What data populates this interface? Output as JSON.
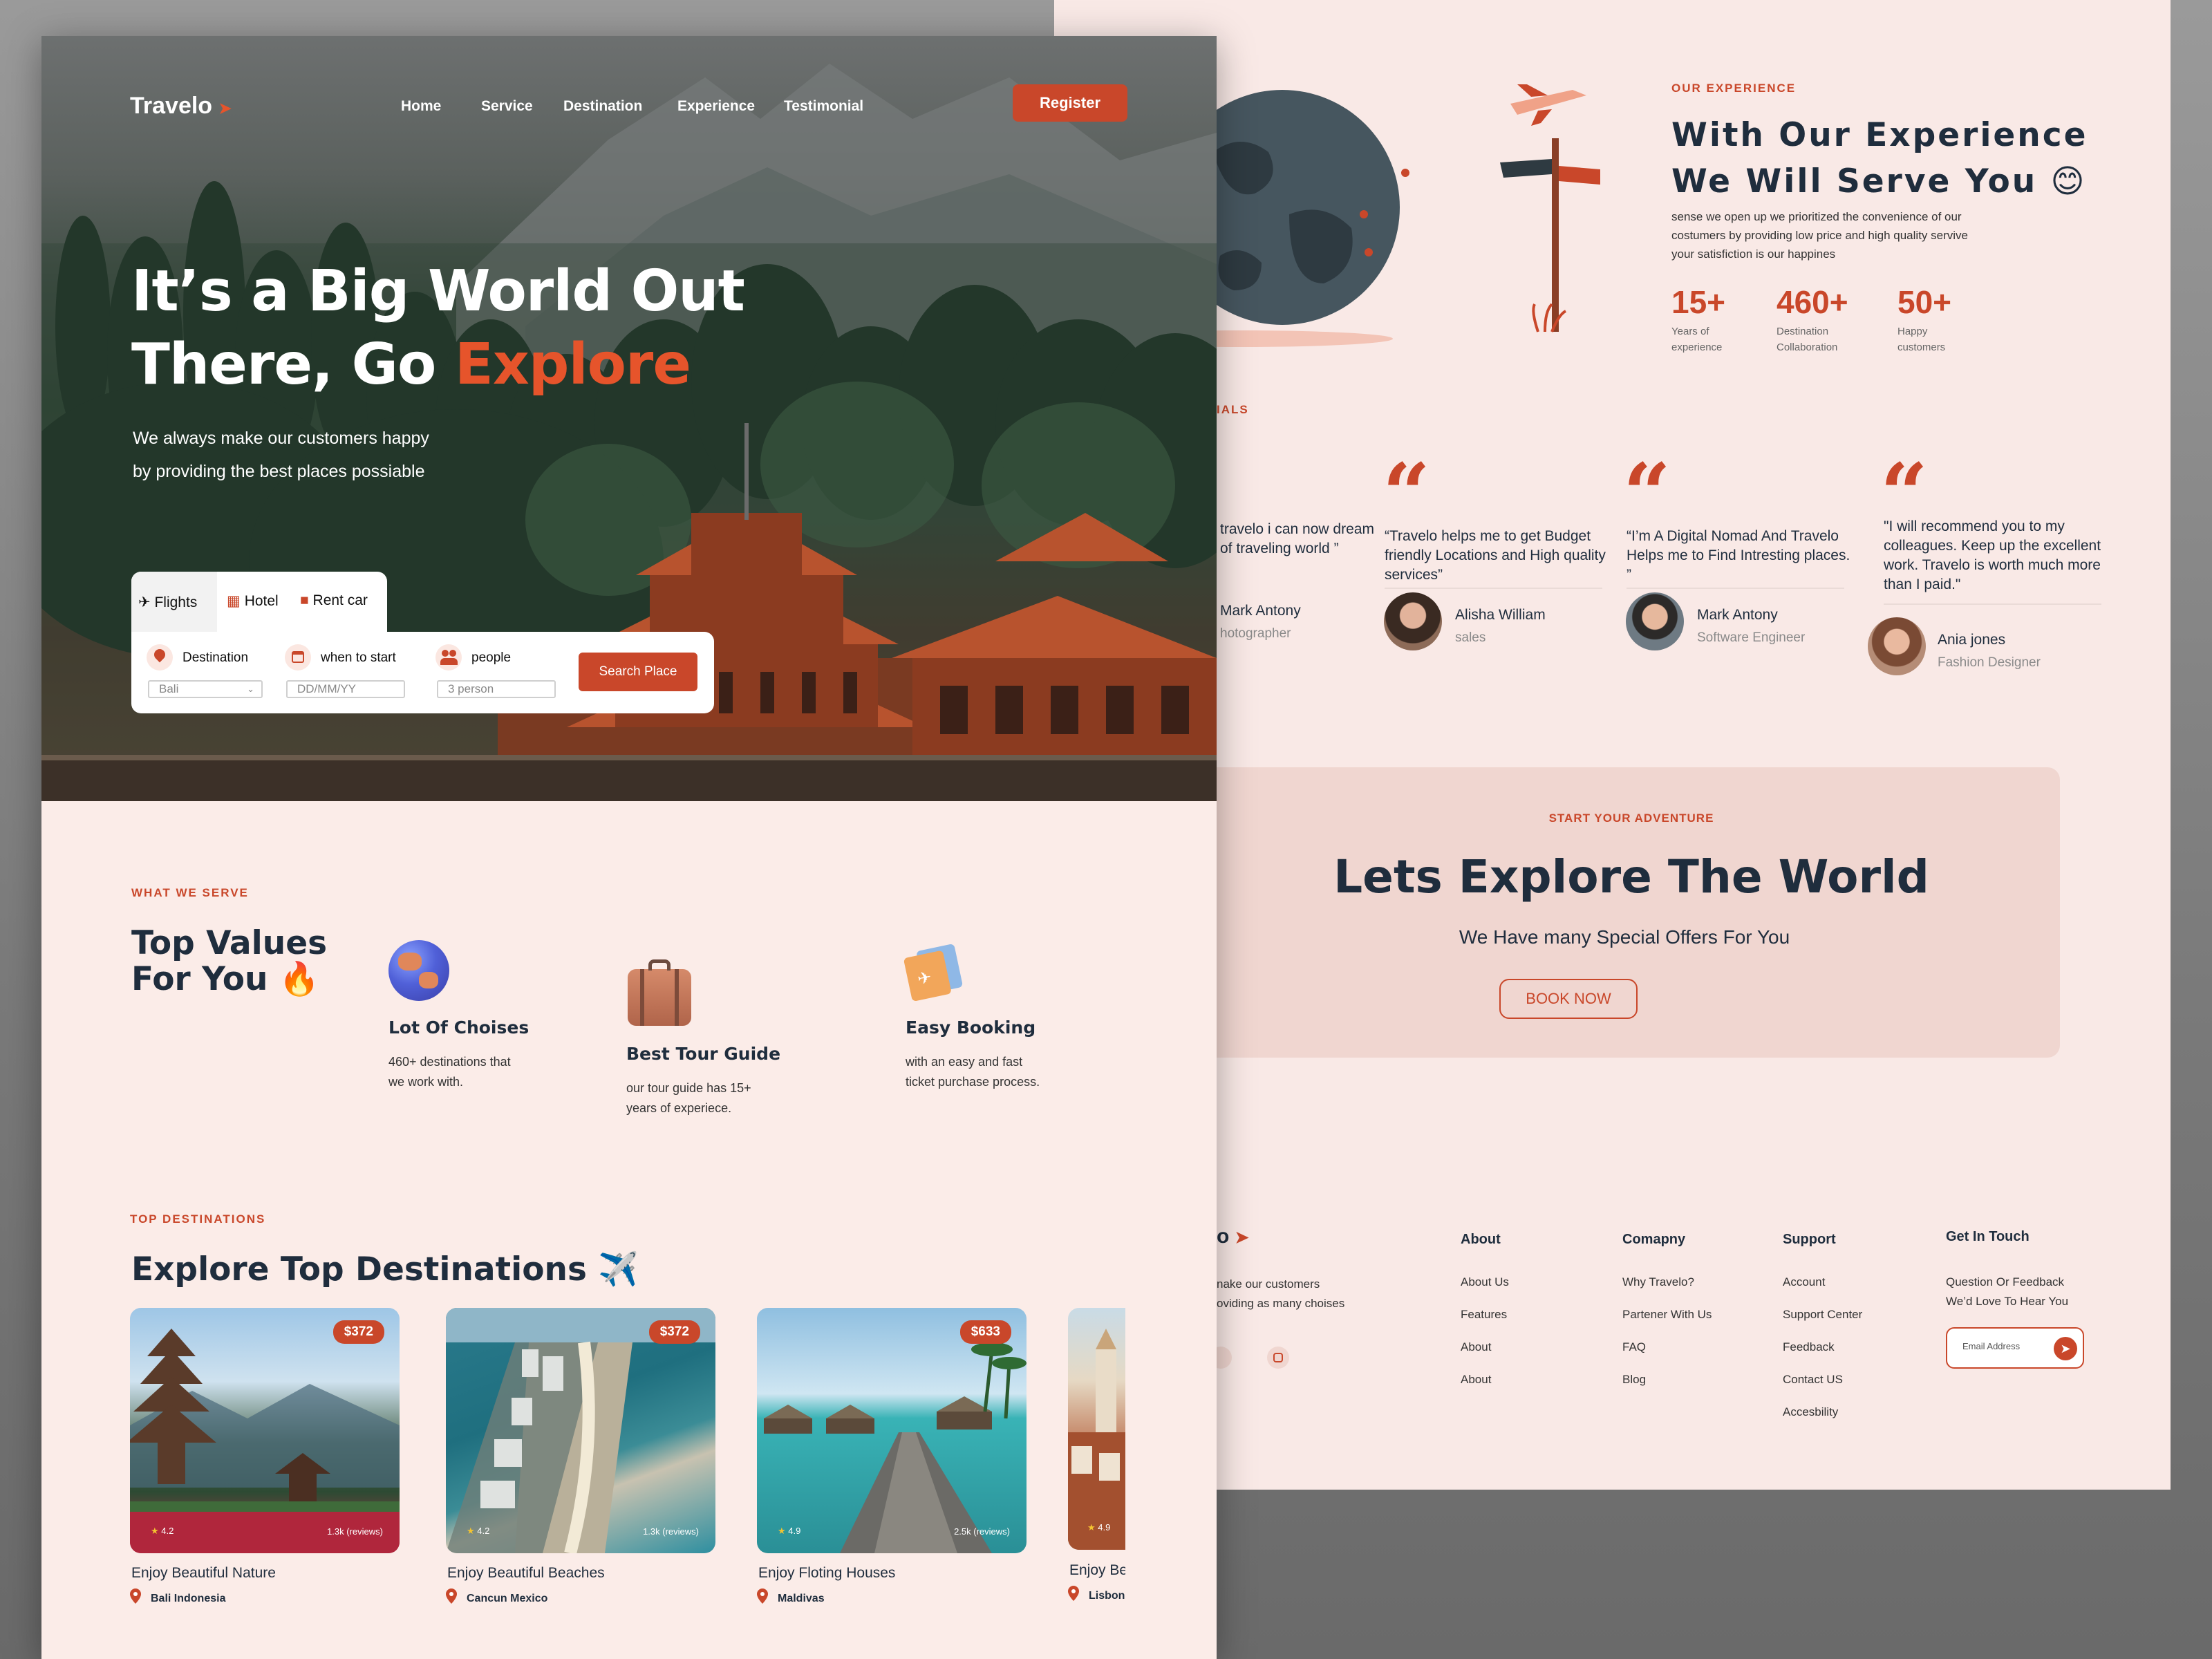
{
  "brand": {
    "name": "Travelo",
    "accent": "#c9472a"
  },
  "nav": {
    "links": [
      "Home",
      "Service",
      "Destination",
      "Experience",
      "Testimonial"
    ],
    "register": "Register"
  },
  "hero": {
    "title_line1": "It’s a Big World Out",
    "title_line2_prefix": "There, Go ",
    "title_line2_accent": "Explore",
    "sub_line1": "We always make our customers happy",
    "sub_line2": "by providing the best places possiable"
  },
  "search": {
    "tabs": [
      {
        "icon": "airplane-icon",
        "label": "Flights"
      },
      {
        "icon": "hotel-icon",
        "label": "Hotel"
      },
      {
        "icon": "car-icon",
        "label": "Rent car"
      }
    ],
    "fields": [
      {
        "icon": "location-pin-icon",
        "label": "Destination",
        "value": "Bali"
      },
      {
        "icon": "calendar-icon",
        "label": "when to start",
        "placeholder": "DD/MM/YY"
      },
      {
        "icon": "people-icon",
        "label": "people",
        "placeholder": "3 person"
      }
    ],
    "button": "Search Place"
  },
  "serve": {
    "eyebrow": "WHAT WE SERVE",
    "title_line1": "Top Values",
    "title_line2": "For You 🔥",
    "features": [
      {
        "icon": "globe-icon",
        "title": "Lot Of Choises",
        "text_line1": "460+ destinations that",
        "text_line2": "we work with."
      },
      {
        "icon": "suitcase-icon",
        "title": "Best Tour Guide",
        "text_line1": "our tour guide has 15+",
        "text_line2": "years of experiece."
      },
      {
        "icon": "ticket-icon",
        "title": "Easy Booking",
        "text_line1": "with an easy and fast",
        "text_line2": "ticket purchase process."
      }
    ]
  },
  "destinations": {
    "eyebrow": "TOP DESTINATIONS",
    "title": "Explore Top Destinations ✈️",
    "cards": [
      {
        "price": "$372",
        "rating": "4.2",
        "reviews": "1.3k (reviews)",
        "title": "Enjoy Beautiful Nature",
        "location": "Bali Indonesia"
      },
      {
        "price": "$372",
        "rating": "4.2",
        "reviews": "1.3k (reviews)",
        "title": "Enjoy Beautiful Beaches",
        "location": "Cancun Mexico"
      },
      {
        "price": "$633",
        "rating": "4.9",
        "reviews": "2.5k (reviews)",
        "title": "Enjoy Floting Houses",
        "location": "Maldivas"
      },
      {
        "price": "",
        "rating": "4.9",
        "reviews": "",
        "title": "Enjoy Be",
        "location": "Lisbon"
      }
    ]
  },
  "experience": {
    "eyebrow": "OUR EXPERIENCE",
    "title_line1": "With Our Experience",
    "title_line2": "We Will Serve You 😊",
    "text": "sense we open up we prioritized the convenience of our costumers by providing low price and high quality servive your satisfiction is our happines",
    "stats": [
      {
        "value": "15+",
        "label_line1": "Years of",
        "label_line2": "experience"
      },
      {
        "value": "460+",
        "label_line1": "Destination",
        "label_line2": "Collaboration"
      },
      {
        "value": "50+",
        "label_line1": "Happy",
        "label_line2": "customers"
      }
    ]
  },
  "testimonials": {
    "eyebrow_visible": "IALS",
    "items": [
      {
        "text": "travelo i can now dream of traveling world ”",
        "name": "Mark Antony",
        "role": "hotographer"
      },
      {
        "text": "“Travelo helps me to get Budget friendly Locations and High quality services”",
        "name": "Alisha William",
        "role": "sales"
      },
      {
        "text": "“I’m A Digital Nomad And Travelo Helps me to Find Intresting places. ”",
        "name": "Mark Antony",
        "role": "Software Engineer"
      },
      {
        "text": "\"I will recommend you to my colleagues. Keep up the excellent work. Travelo is worth much more than I paid.\"",
        "name": "Ania jones",
        "role": "Fashion Designer"
      }
    ]
  },
  "cta": {
    "eyebrow": "START YOUR ADVENTURE",
    "title": "Lets Explore The World",
    "subtitle": "We Have many Special Offers For You",
    "button": "BOOK NOW"
  },
  "footer": {
    "tagline_line1": "nake our customers",
    "tagline_line2": "oviding as many choises",
    "columns": [
      {
        "title": "About",
        "links": [
          "About Us",
          "Features",
          "About",
          "About"
        ]
      },
      {
        "title": "Comapny",
        "links": [
          "Why Travelo?",
          "Partener With Us",
          "FAQ",
          "Blog"
        ]
      },
      {
        "title": "Support",
        "links": [
          "Account",
          "Support Center",
          "Feedback",
          "Contact US",
          "Accesbility"
        ]
      }
    ],
    "contact": {
      "title": "Get In Touch",
      "line1": "Question Or Feedback",
      "line2": "We’d Love To Hear You",
      "placeholder": "Email Address"
    }
  }
}
